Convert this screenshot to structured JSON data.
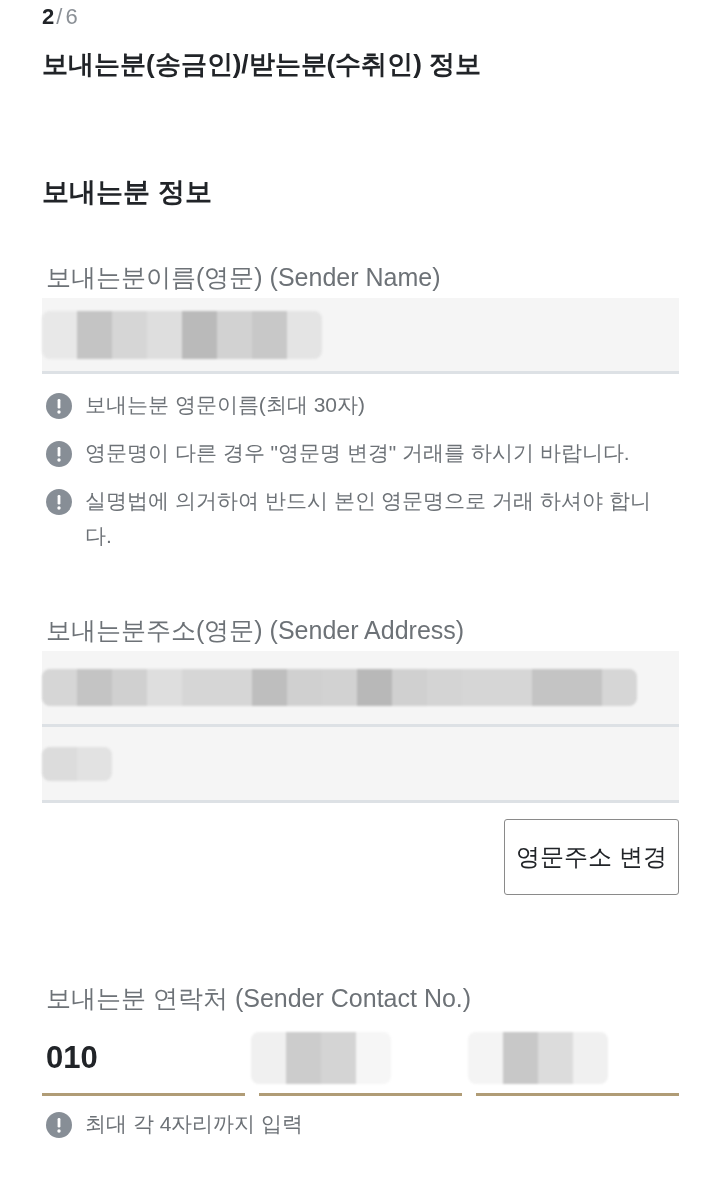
{
  "step": {
    "current": "2",
    "separator": "/",
    "total": "6"
  },
  "title": "보내는분(송금인)/받는분(수취인) 정보",
  "section": {
    "heading": "보내는분 정보",
    "fields": [
      {
        "kind": "boxed",
        "label": "보내는분이름(영문) (Sender Name)",
        "inputs": [
          {
            "redacted": true
          }
        ],
        "notes": [
          "보내는분 영문이름(최대 30자)",
          "영문명이 다른 경우 \"영문명 변경\" 거래를 하시기 바랍니다.",
          "실명법에 의거하여 반드시 본인 영문명으로 거래 하셔야 합니다."
        ]
      },
      {
        "kind": "boxed",
        "label": "보내는분주소(영문) (Sender Address)",
        "inputs": [
          {
            "redacted": true
          },
          {
            "redacted": true
          }
        ],
        "button": "영문주소 변경"
      },
      {
        "kind": "segmented",
        "label": "보내는분 연락처 (Sender Contact No.)",
        "inputs": [
          {
            "value": "010",
            "redacted": false
          },
          {
            "redacted": true
          },
          {
            "redacted": true
          }
        ],
        "notes": [
          "최대 각 4자리까지 입력"
        ]
      }
    ]
  }
}
